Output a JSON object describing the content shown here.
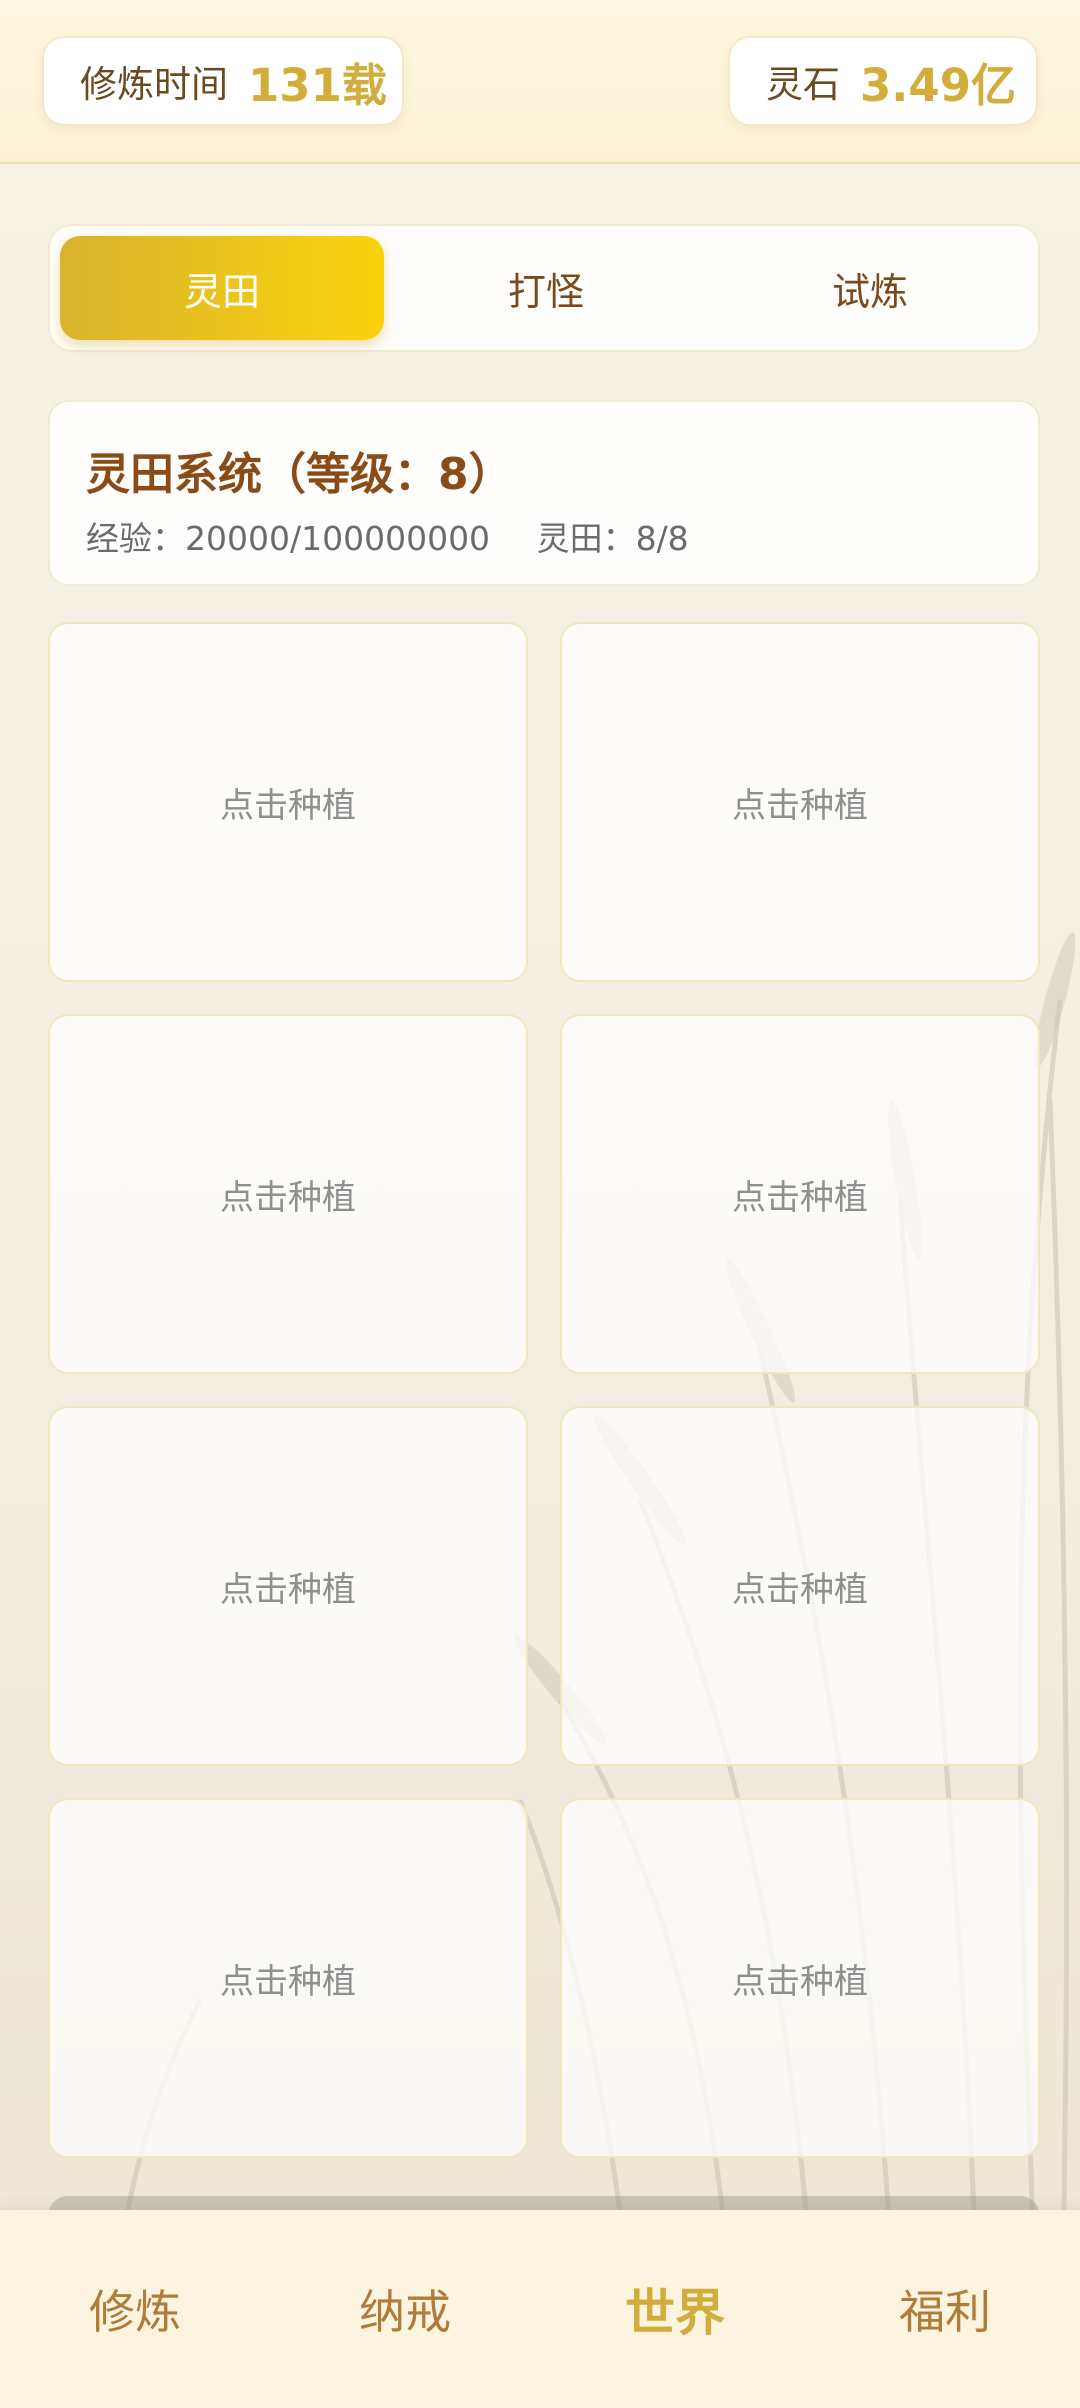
{
  "header": {
    "cultivation_label": "修炼时间",
    "cultivation_value": "131载",
    "stone_label": "灵石",
    "stone_value": "3.49亿"
  },
  "tabs": [
    {
      "label": "灵田",
      "active": true
    },
    {
      "label": "打怪",
      "active": false
    },
    {
      "label": "试炼",
      "active": false
    }
  ],
  "field_system": {
    "title": "灵田系统（等级：8）",
    "exp": "经验：20000/100000000",
    "fields": "灵田：8/8"
  },
  "plots": [
    {
      "label": "点击种植"
    },
    {
      "label": "点击种植"
    },
    {
      "label": "点击种植"
    },
    {
      "label": "点击种植"
    },
    {
      "label": "点击种植"
    },
    {
      "label": "点击种植"
    },
    {
      "label": "点击种植"
    },
    {
      "label": "点击种植"
    }
  ],
  "nav": [
    {
      "label": "修炼",
      "active": false
    },
    {
      "label": "纳戒",
      "active": false
    },
    {
      "label": "世界",
      "active": true
    },
    {
      "label": "福利",
      "active": false
    }
  ],
  "colors": {
    "accent": "#d2ad3b",
    "title_brown": "#8a4b16",
    "nav_brown": "#b07c3a"
  }
}
